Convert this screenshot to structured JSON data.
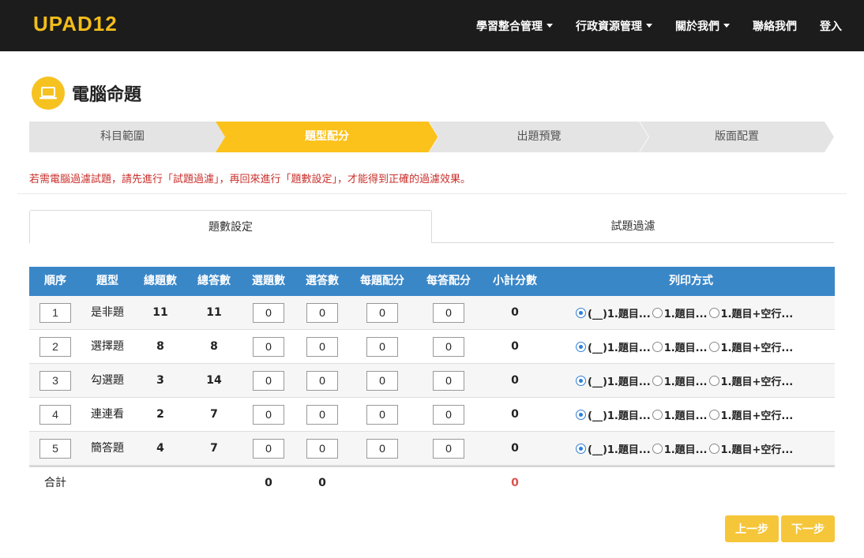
{
  "app": {
    "logo": "UPAD12"
  },
  "nav": [
    {
      "label": "學習整合管理",
      "dropdown": true
    },
    {
      "label": "行政資源管理",
      "dropdown": true
    },
    {
      "label": "關於我們",
      "dropdown": true
    },
    {
      "label": "聯絡我們",
      "dropdown": false
    },
    {
      "label": "登入",
      "dropdown": false
    }
  ],
  "page": {
    "title": "電腦命題",
    "icon": "laptop-icon"
  },
  "steps": [
    {
      "label": "科目範圍",
      "active": false
    },
    {
      "label": "題型配分",
      "active": true
    },
    {
      "label": "出題預覽",
      "active": false
    },
    {
      "label": "版面配置",
      "active": false
    }
  ],
  "notice": "若需電腦過濾試題，請先進行「試題過濾」，再回來進行「題數設定」，才能得到正確的過濾效果。",
  "tabs": [
    {
      "label": "題數設定",
      "active": true
    },
    {
      "label": "試題過濾",
      "active": false
    }
  ],
  "table": {
    "headers": [
      "順序",
      "題型",
      "總題數",
      "總答數",
      "選題數",
      "選答數",
      "每題配分",
      "每答配分",
      "小計分數",
      "列印方式"
    ],
    "rows": [
      {
        "order": "1",
        "type": "是非題",
        "total_questions": "11",
        "total_answers": "11",
        "sel_questions": "0",
        "sel_answers": "0",
        "per_question": "0",
        "per_answer": "0",
        "subtotal": "0"
      },
      {
        "order": "2",
        "type": "選擇題",
        "total_questions": "8",
        "total_answers": "8",
        "sel_questions": "0",
        "sel_answers": "0",
        "per_question": "0",
        "per_answer": "0",
        "subtotal": "0"
      },
      {
        "order": "3",
        "type": "勾選題",
        "total_questions": "3",
        "total_answers": "14",
        "sel_questions": "0",
        "sel_answers": "0",
        "per_question": "0",
        "per_answer": "0",
        "subtotal": "0"
      },
      {
        "order": "4",
        "type": "連連看",
        "total_questions": "2",
        "total_answers": "7",
        "sel_questions": "0",
        "sel_answers": "0",
        "per_question": "0",
        "per_answer": "0",
        "subtotal": "0"
      },
      {
        "order": "5",
        "type": "簡答題",
        "total_questions": "4",
        "total_answers": "7",
        "sel_questions": "0",
        "sel_answers": "0",
        "per_question": "0",
        "per_answer": "0",
        "subtotal": "0"
      }
    ],
    "print_options": [
      "(__)1.題目...",
      "1.題目...",
      "1.題目+空行..."
    ],
    "print_selected": 0,
    "total": {
      "label": "合計",
      "sel_questions": "0",
      "sel_answers": "0",
      "subtotal": "0"
    }
  },
  "buttons": {
    "prev": "上一步",
    "next": "下一步"
  },
  "colors": {
    "accent": "#f6c220",
    "header_blue": "#3a87c8",
    "navbar": "#1c1c1c",
    "warning_red": "#c9302c"
  }
}
